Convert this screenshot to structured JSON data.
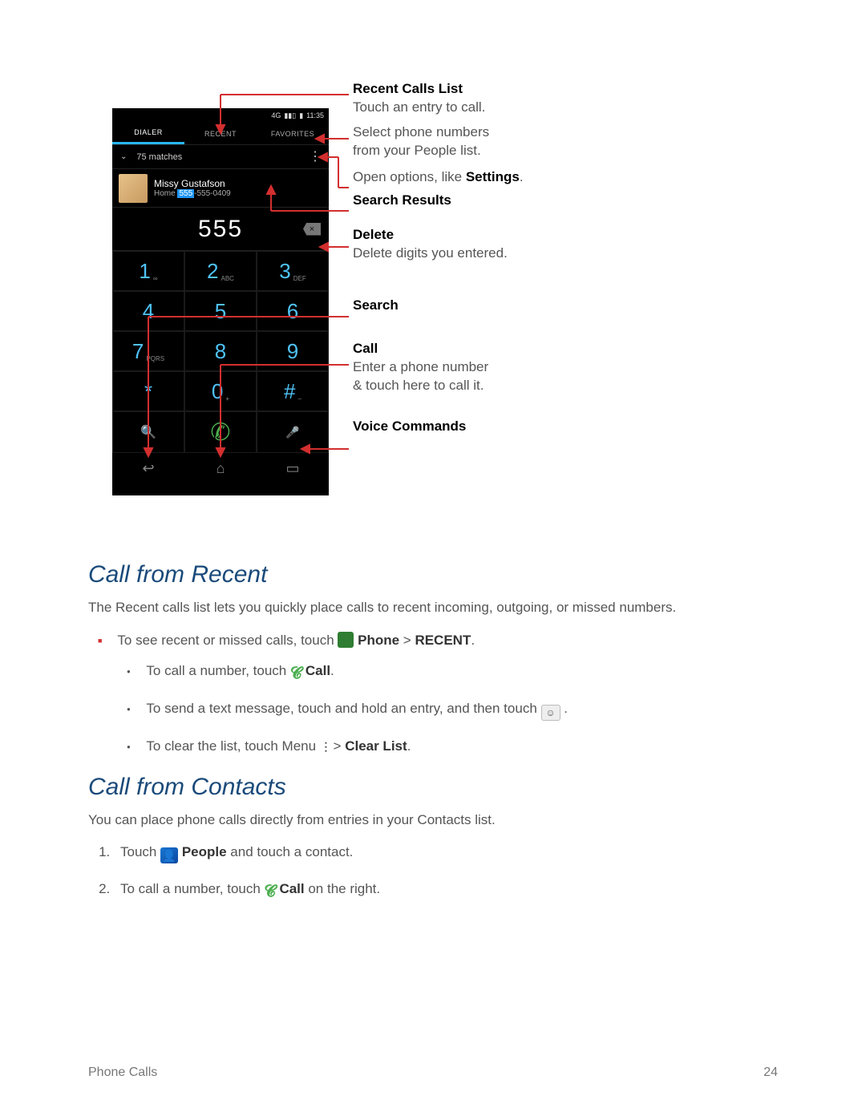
{
  "phone": {
    "status_time": "11:35",
    "status_net": "4G",
    "tabs": [
      "DIALER",
      "RECENT",
      "FAVORITES"
    ],
    "active_tab": 0,
    "matches_text": "75 matches",
    "contact_name": "Missy Gustafson",
    "contact_phone_prefix": "Home ",
    "contact_phone_hl": "555",
    "contact_phone_rest": "-555-0409",
    "dialed": "555",
    "keys": [
      {
        "d": "1",
        "l": "∞"
      },
      {
        "d": "2",
        "l": "ABC"
      },
      {
        "d": "3",
        "l": "DEF"
      },
      {
        "d": "4",
        "l": ""
      },
      {
        "d": "5",
        "l": ""
      },
      {
        "d": "6",
        "l": ""
      },
      {
        "d": "7",
        "l": "PQRS"
      },
      {
        "d": "8",
        "l": ""
      },
      {
        "d": "9",
        "l": ""
      },
      {
        "d": "*",
        "l": ""
      },
      {
        "d": "0",
        "l": "+"
      },
      {
        "d": "#",
        "l": "–"
      }
    ]
  },
  "callouts": {
    "recent_b": "Recent Calls List",
    "recent_t": "Touch an entry to call.",
    "fav_t1": "Select phone numbers",
    "fav_t2": "from your People list.",
    "opt_t1": "Open options, like ",
    "opt_b": "Settings",
    "sr_b": "Search Results",
    "del_b": "Delete",
    "del_t": "Delete digits you entered.",
    "search_b": "Search",
    "call_b": "Call",
    "call_t1": "Enter a phone number",
    "call_t2": "& touch here to call it.",
    "vc_b": "Voice Commands"
  },
  "doc": {
    "h1": "Call from Recent",
    "p1": "The Recent calls list lets you quickly place calls to recent incoming, outgoing, or missed numbers.",
    "b1_a": "To see recent or missed calls, touch ",
    "b1_b": " Phone",
    "b1_c": " > ",
    "b1_d": "RECENT",
    "b1_e": ".",
    "s1_a": "To call a number, touch ",
    "s1_b": " Call",
    "s1_c": ".",
    "s2_a": "To send a text message, touch and hold an entry, and then touch ",
    "s2_b": " .",
    "s3_a": "To clear the list, touch Menu ",
    "s3_b": " > ",
    "s3_c": "Clear List",
    "s3_d": ".",
    "h2": "Call from Contacts",
    "p2": "You can place phone calls directly from entries in your Contacts list.",
    "o1_a": "Touch ",
    "o1_b": " People",
    "o1_c": " and touch a contact.",
    "o2_a": "To call a number, touch ",
    "o2_b": " Call",
    "o2_c": " on the right.",
    "footer_l": "Phone Calls",
    "footer_r": "24"
  }
}
